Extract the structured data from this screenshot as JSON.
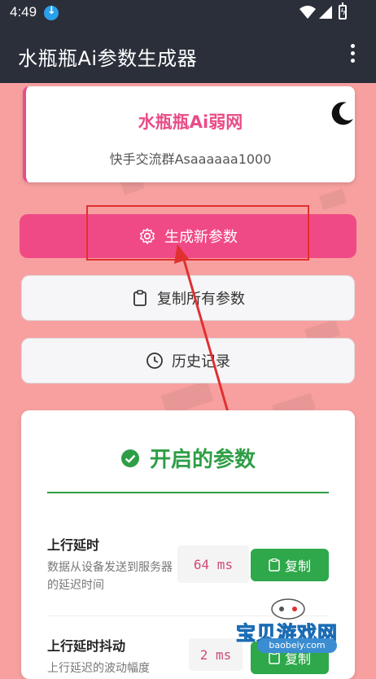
{
  "status_bar": {
    "time": "4:49"
  },
  "app_bar": {
    "title": "水瓶瓶Ai参数生成器"
  },
  "header": {
    "title": "水瓶瓶Ai弱网",
    "subtitle": "快手交流群Asaaaaaa1000"
  },
  "actions": {
    "generate_label": "生成新参数",
    "copy_all_label": "复制所有参数",
    "history_label": "历史记录"
  },
  "params": {
    "title": "开启的参数",
    "items": [
      {
        "name": "上行延时",
        "desc": "数据从设备发送到服务器的延迟时间",
        "value": "64 ms",
        "copy_label": "复制"
      },
      {
        "name": "上行延时抖动",
        "desc": "上行延迟的波动幅度",
        "value": "2 ms",
        "copy_label": "复制"
      }
    ]
  },
  "watermark": {
    "text": "宝贝游戏网",
    "url": "baobeiy.com"
  },
  "colors": {
    "accent": "#f04a86",
    "success": "#2e9e46",
    "appbar": "#2b2f3a",
    "background": "#f8a0a0"
  }
}
